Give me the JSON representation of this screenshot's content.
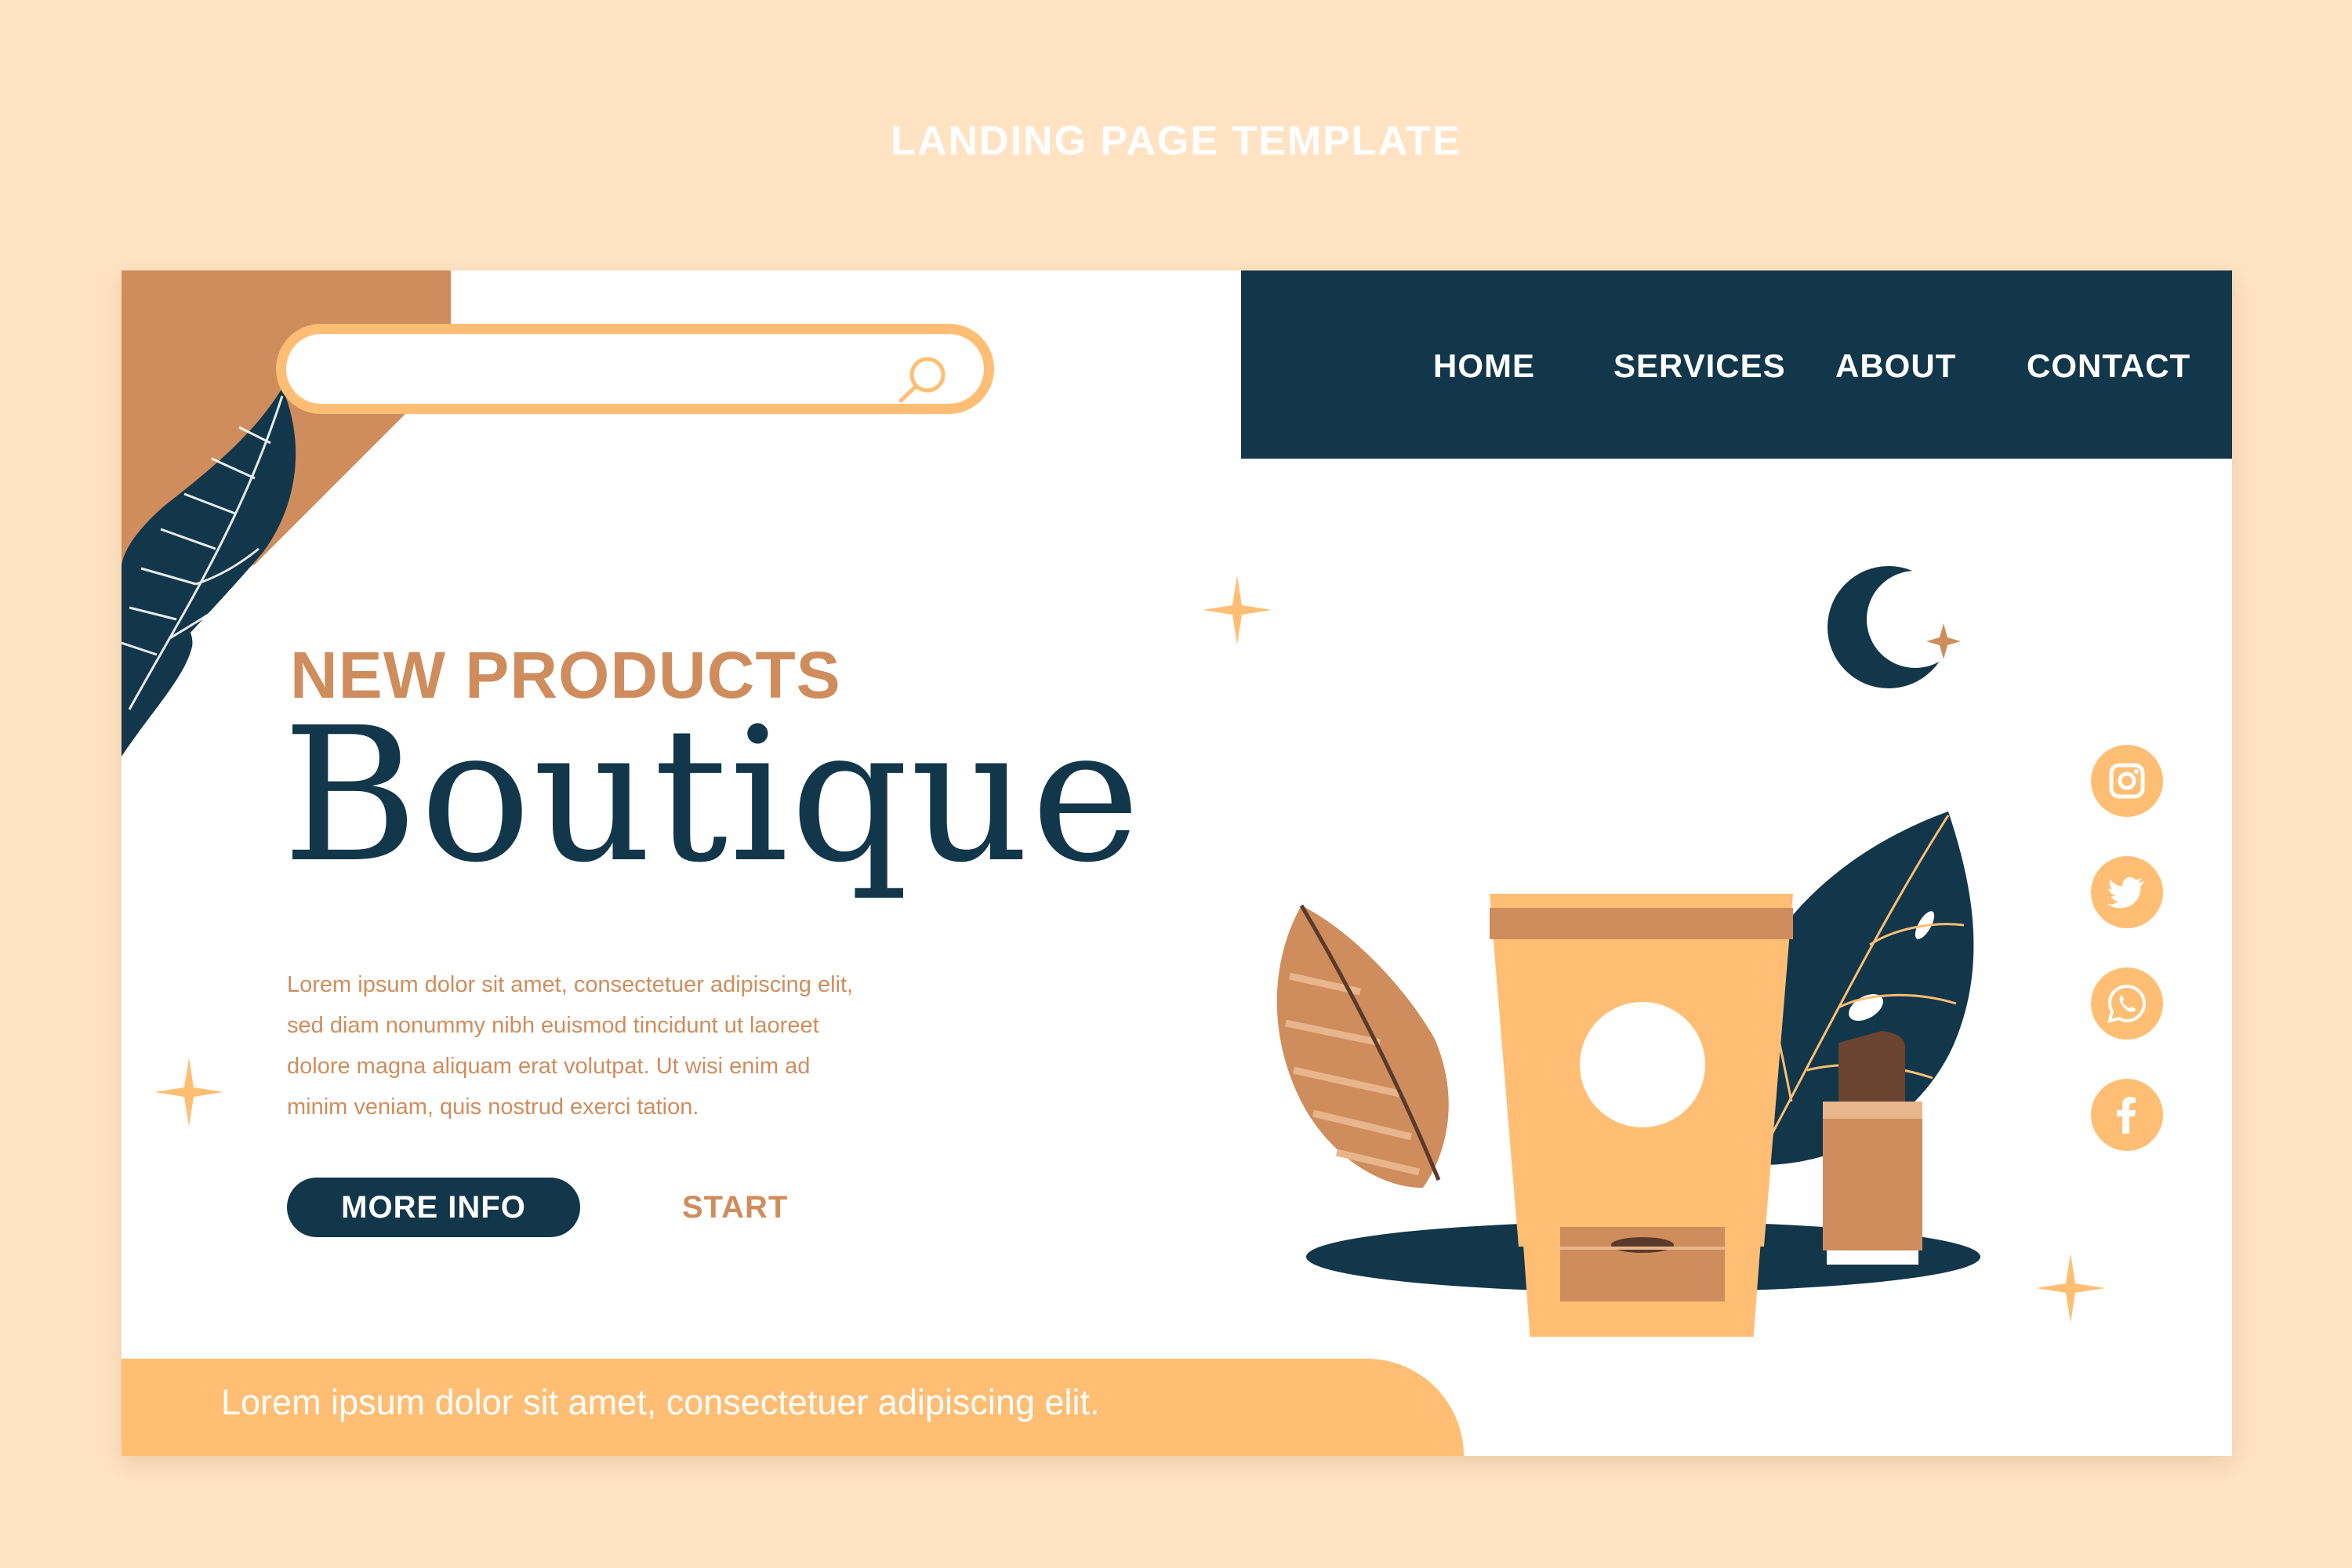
{
  "page": {
    "title": "LANDING PAGE TEMPLATE"
  },
  "search": {
    "value": "",
    "placeholder": "",
    "icon": "search-icon"
  },
  "nav": {
    "items": [
      "HOME",
      "SERVICES",
      "ABOUT",
      "CONTACT"
    ]
  },
  "hero": {
    "eyebrow": "NEW PRODUCTS",
    "title": "Boutique",
    "body_lines": [
      "Lorem ipsum dolor sit amet, consectetuer adipiscing elit,",
      "sed diam nonummy nibh euismod tincidunt ut laoreet",
      "dolore magna aliquam erat volutpat. Ut wisi enim ad",
      "minim veniam, quis nostrud exerci tation."
    ],
    "primary_button": "MORE INFO",
    "secondary_button": "START"
  },
  "footer": {
    "text": "Lorem ipsum dolor sit amet, consectetuer adipiscing elit."
  },
  "social": {
    "icons": [
      "instagram-icon",
      "twitter-icon",
      "whatsapp-icon",
      "facebook-icon"
    ]
  },
  "colors": {
    "page_background": "#FFE3C3",
    "navy": "#12364A",
    "caramel": "#CF8D5D",
    "peach": "#FFBE73",
    "white": "#FFFFFF",
    "lipstick": "#6B4331"
  }
}
